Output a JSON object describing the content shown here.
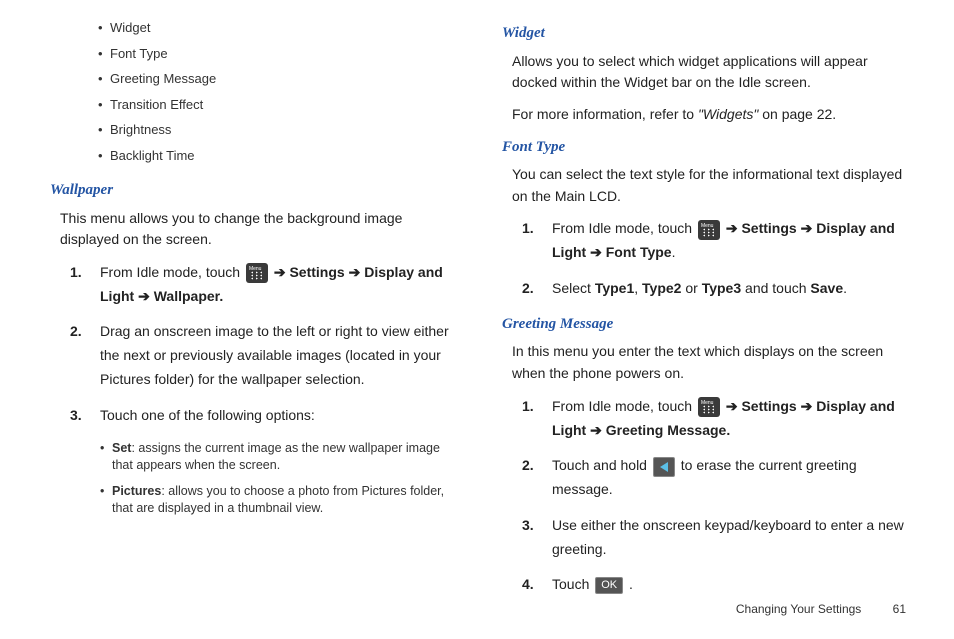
{
  "left": {
    "bullets": [
      "Widget",
      "Font Type",
      "Greeting Message",
      "Transition Effect",
      "Brightness",
      "Backlight Time"
    ],
    "wallpaper": {
      "heading": "Wallpaper",
      "intro": "This menu allows you to change the background image displayed on the screen.",
      "step1_a": "From Idle mode, touch ",
      "step1_b": " ➔ ",
      "step1_settings": "Settings",
      "step1_c": " ➔ ",
      "step1_display": "Display and Light",
      "step1_d": " ➔ ",
      "step1_wallpaper": "Wallpaper.",
      "step2": "Drag an onscreen image to the left or right to view either the next or previously available images (located in your Pictures folder) for the wallpaper selection.",
      "step3": "Touch one of the following options:",
      "sub_set_b": "Set",
      "sub_set_t": ": assigns the current image as the new wallpaper image that appears when the screen.",
      "sub_pic_b": "Pictures",
      "sub_pic_t": ": allows you to choose a photo from Pictures folder, that are displayed in a thumbnail view."
    }
  },
  "right": {
    "widget": {
      "heading": "Widget",
      "p1": "Allows you to select which widget applications will appear docked within the Widget bar on the Idle screen.",
      "p2a": "For more information, refer to ",
      "p2b": "\"Widgets\"",
      "p2c": "  on page 22."
    },
    "font": {
      "heading": "Font Type",
      "intro": "You can select the text style for the informational text displayed on the Main LCD.",
      "s1a": "From Idle mode, touch ",
      "s1b": " ➔ ",
      "s1_settings": "Settings",
      "s1c": " ➔ ",
      "s1_display": "Display and Light",
      "s1d": " ➔ ",
      "s1_font": "Font Type",
      "s1e": ".",
      "s2a": "Select ",
      "s2_t1": "Type1",
      "s2b": ", ",
      "s2_t2": "Type2",
      "s2c": " or ",
      "s2_t3": "Type3",
      "s2d": " and touch ",
      "s2_save": "Save",
      "s2e": "."
    },
    "greeting": {
      "heading": "Greeting Message",
      "intro": "In this menu you enter the text which displays on the screen when the phone powers on.",
      "s1a": "From Idle mode, touch ",
      "s1b": " ➔ ",
      "s1_settings": "Settings",
      "s1c": " ➔ ",
      "s1_display": "Display and Light",
      "s1d": " ➔ ",
      "s1_gm": "Greeting Message.",
      "s2a": "Touch and hold ",
      "s2b": " to erase the current greeting message.",
      "s3": "Use either the onscreen keypad/keyboard to enter a new greeting.",
      "s4a": "Touch ",
      "s4_ok": "OK",
      "s4b": " ."
    }
  },
  "footer": {
    "section": "Changing Your Settings",
    "page": "61"
  }
}
